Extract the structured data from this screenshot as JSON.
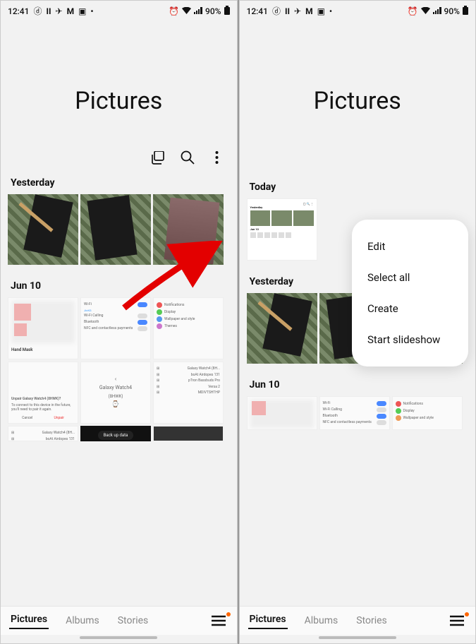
{
  "status": {
    "time": "12:41",
    "battery": "90%"
  },
  "left": {
    "title": "Pictures",
    "sections": {
      "s1": "Yesterday",
      "s2": "Jun 10"
    },
    "shot_rows": {
      "wifi": "Wi-Fi",
      "wifi_sub": "JioKG",
      "wfcall": "Wi-Fi Calling",
      "bt": "Bluetooth",
      "nfc": "NFC and contactless payments",
      "notif": "Notifications",
      "display": "Display",
      "wall": "Wallpaper and style",
      "themes": "Themes"
    },
    "hand": "Hand Mask",
    "dialog": {
      "title": "Unpair Galaxy Watch4 (8HWK)?",
      "body": "To connect to this device in the future, you'll need to pair it again.",
      "cancel": "Cancel",
      "unpair": "Unpair"
    },
    "watch": {
      "name": "Galaxy Watch4",
      "id": "(8HWK)"
    },
    "bt_list": {
      "a": "Galaxy Watch4 (8H...",
      "b": "boAt Airdopes 131",
      "c": "pTron Bassbuds Pro",
      "d": "Versa 2",
      "e": "MDIVTSHTHP"
    },
    "backup": "Back up data",
    "tabs": {
      "pictures": "Pictures",
      "albums": "Albums",
      "stories": "Stories"
    }
  },
  "right": {
    "title": "Pictures",
    "sections": {
      "s0": "Today",
      "s1": "Yesterday",
      "s2": "Jun 10"
    },
    "mini_labels": {
      "yest": "Yesterday",
      "j10": "Jun 10"
    },
    "menu": {
      "edit": "Edit",
      "selall": "Select all",
      "create": "Create",
      "slide": "Start slideshow"
    },
    "shot_rows": {
      "wifi": "Wi-Fi",
      "wfcall": "Wi-Fi Calling",
      "bt": "Bluetooth",
      "nfc": "NFC and contactless payments",
      "notif": "Notifications",
      "display": "Display",
      "wall": "Wallpaper and style"
    },
    "tabs": {
      "pictures": "Pictures",
      "albums": "Albums",
      "stories": "Stories"
    }
  }
}
